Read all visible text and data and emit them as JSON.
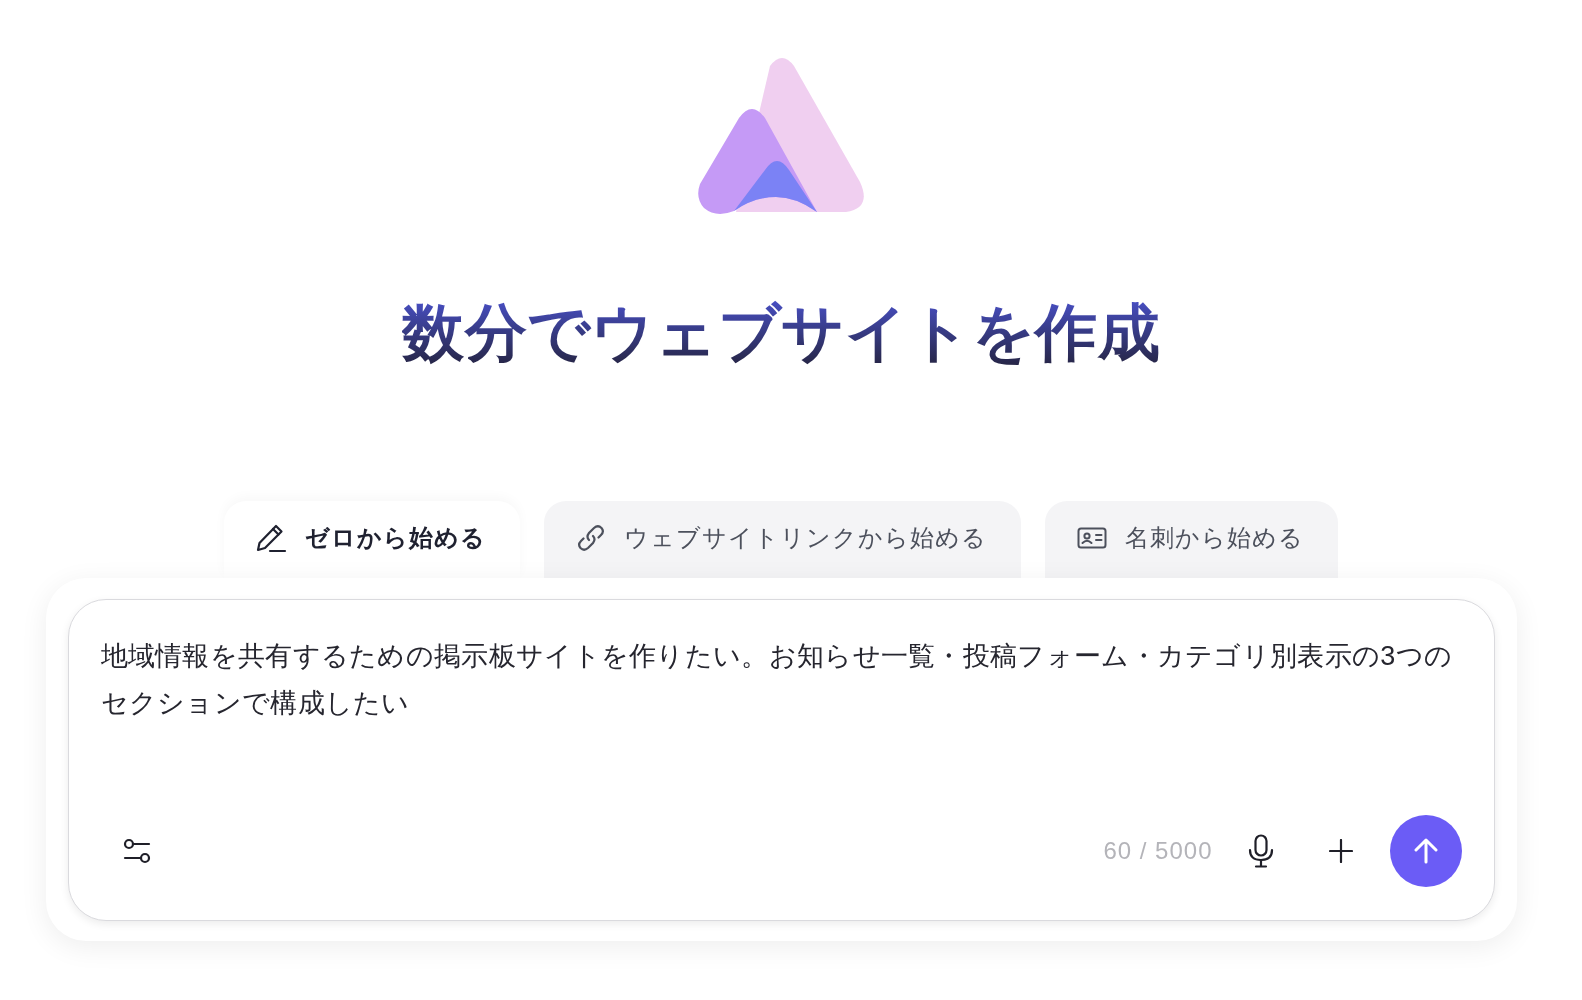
{
  "heading": "数分でウェブサイトを作成",
  "tabs": [
    {
      "label": "ゼロから始める",
      "selected": true
    },
    {
      "label": "ウェブサイトリンクから始める",
      "selected": false
    },
    {
      "label": "名刺から始める",
      "selected": false
    }
  ],
  "prompt": {
    "value": "地域情報を共有するための掲示板サイトを作りたい。お知らせ一覧・投稿フォーム・カテゴリ別表示の3つのセクションで構成したい",
    "counter": "60 / 5000"
  }
}
